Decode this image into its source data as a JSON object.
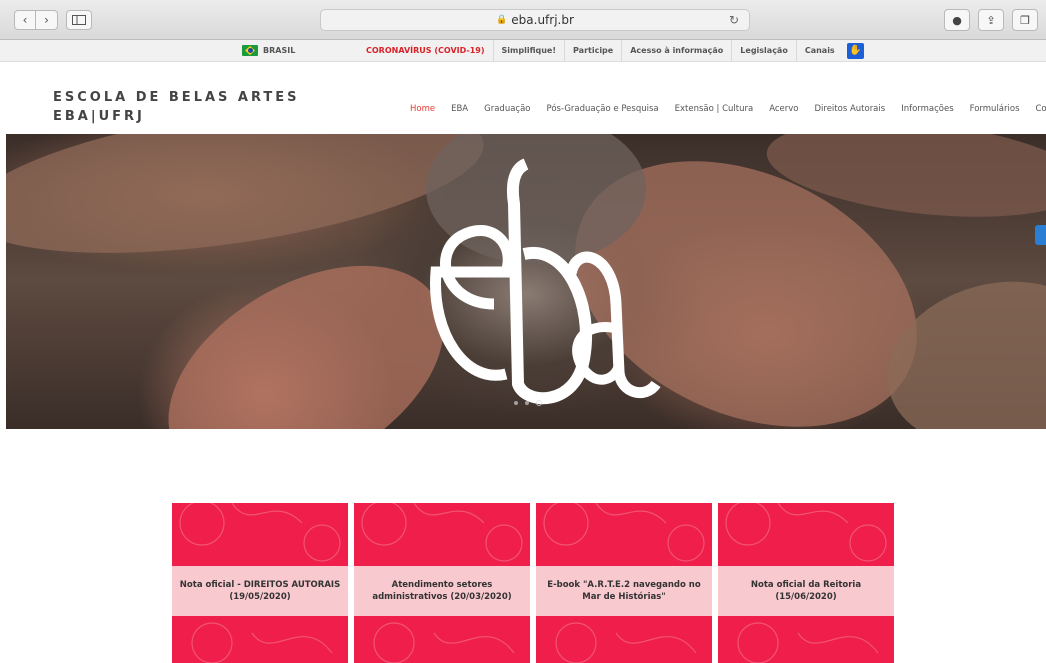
{
  "browser": {
    "url": "eba.ufrj.br"
  },
  "govbar": {
    "brasil": "BRASIL",
    "links": [
      "CORONAVÍRUS (COVID-19)",
      "Simplifique!",
      "Participe",
      "Acesso à informação",
      "Legislação",
      "Canais"
    ]
  },
  "header": {
    "brand_line1": "ESCOLA DE BELAS ARTES",
    "brand_line2": "EBA|UFRJ"
  },
  "nav": {
    "items": [
      "Home",
      "EBA",
      "Graduação",
      "Pós-Graduação e Pesquisa",
      "Extensão | Cultura",
      "Acervo",
      "Direitos Autorais",
      "Informações",
      "Formulários",
      "Contato"
    ]
  },
  "hero": {
    "logo": "eba",
    "slides_total": 3,
    "slide_active": 3
  },
  "cards": [
    {
      "title": "Nota oficial - DIREITOS AUTORAIS (19/05/2020)"
    },
    {
      "title": "Atendimento setores administrativos (20/03/2020)"
    },
    {
      "title": "E-book \"A.R.T.E.2 navegando no Mar de Histórias\""
    },
    {
      "title": "Nota oficial da Reitoria (15/06/2020)"
    }
  ],
  "colors": {
    "accent": "#e8392f",
    "card_red": "#ef1e4a",
    "card_band": "#f8c9cf",
    "gov_link_red": "#d8232a"
  }
}
